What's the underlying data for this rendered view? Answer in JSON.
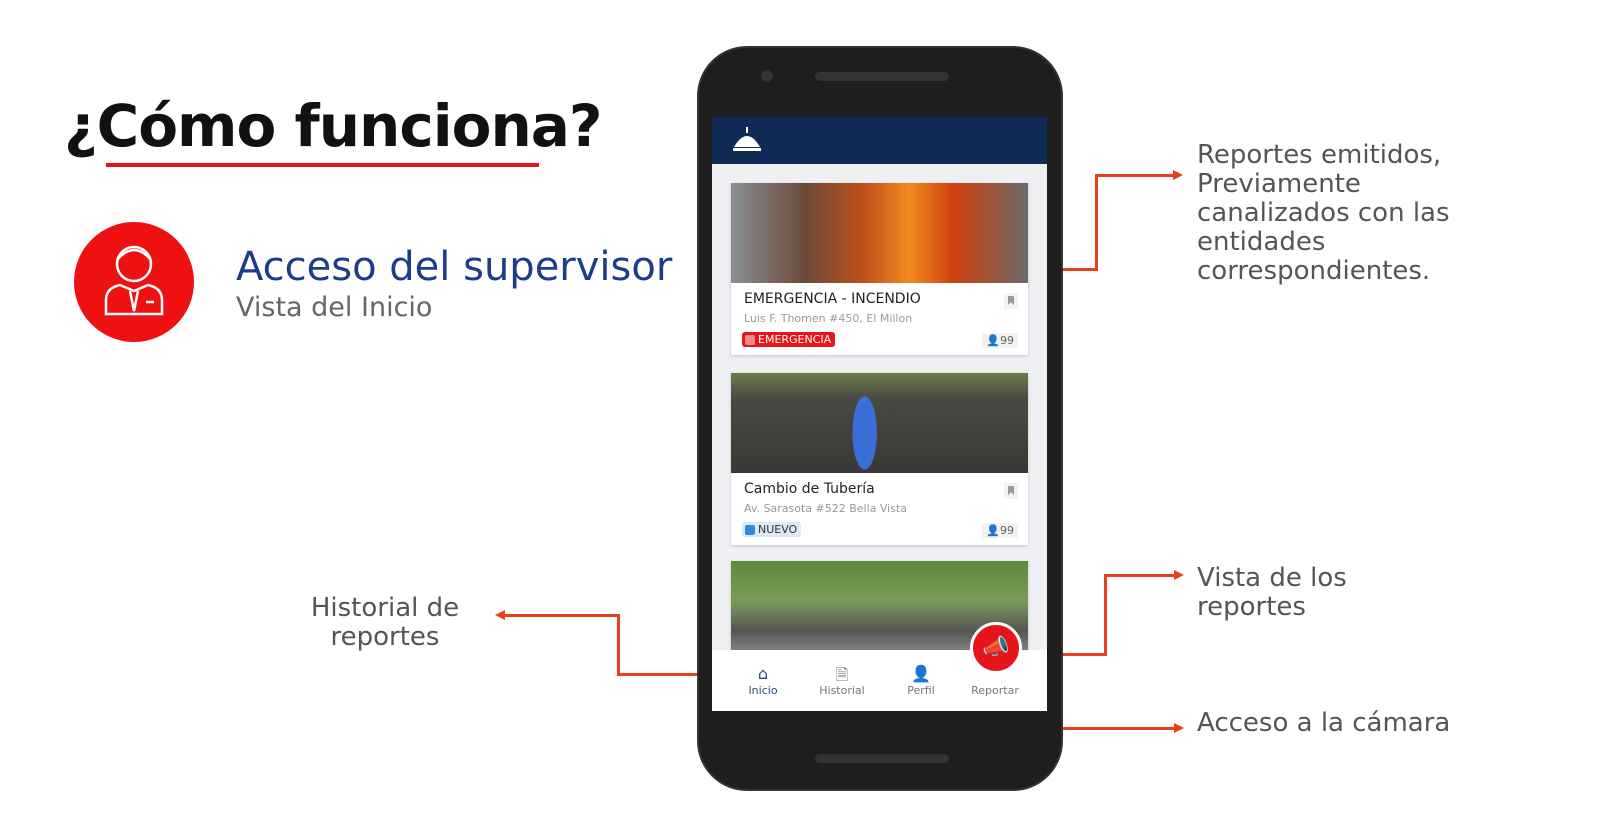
{
  "slide": {
    "title": "¿Cómo funciona?",
    "heading": "Acceso del supervisor",
    "subheading": "Vista del Inicio",
    "accent": "#e3141b",
    "heading_color": "#1d3d8c"
  },
  "annotations": {
    "reports": "Reportes emitidos, Previamente canalizados con las entidades correspondientes.",
    "history": "Historial de reportes",
    "view": "Vista de los reportes",
    "camera": "Acceso a la cámara"
  },
  "app": {
    "header_logo": "capitol-dome-icon",
    "cards": [
      {
        "title": "EMERGENCIA - INCENDIO",
        "address": "Luis F. Thomen #450, El Millon",
        "badge": "EMERGENCIA",
        "badge_color": "#e8141b",
        "count": "99"
      },
      {
        "title": "Cambio de Tubería",
        "address": "Av. Sarasota #522 Bella Vista",
        "badge": "NUEVO",
        "badge_color": "#2b8be0",
        "count": "99"
      }
    ],
    "nav": [
      {
        "label": "Inicio",
        "icon": "home-icon",
        "active": true
      },
      {
        "label": "Historial",
        "icon": "history-icon"
      },
      {
        "label": "Perfil",
        "icon": "user-icon"
      },
      {
        "label": "Reportar",
        "icon": "megaphone-icon"
      }
    ]
  }
}
